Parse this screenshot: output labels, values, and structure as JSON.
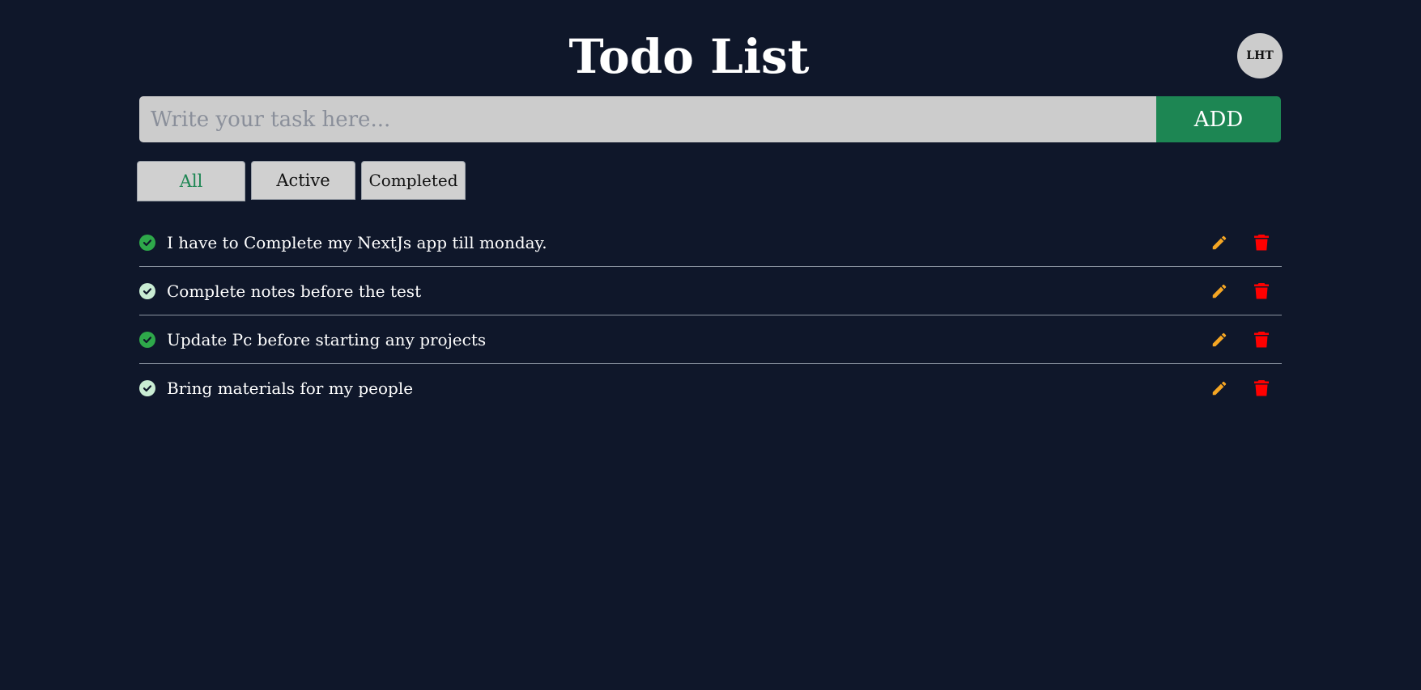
{
  "header": {
    "title": "Todo List",
    "avatar_initials": "LHT"
  },
  "add_form": {
    "placeholder": "Write your task here...",
    "value": "",
    "add_label": "ADD"
  },
  "tabs": [
    {
      "label": "All",
      "active": true
    },
    {
      "label": "Active",
      "active": false
    },
    {
      "label": "Completed",
      "active": false
    }
  ],
  "todos": [
    {
      "text": "I have to Complete my NextJs app till monday.",
      "status_icon": "check-circle-icon",
      "check_color": "#2ea84a"
    },
    {
      "text": "Complete notes before the test",
      "status_icon": "check-circle-icon",
      "check_color": "#c9ecd3"
    },
    {
      "text": "Update Pc before starting any projects",
      "status_icon": "check-circle-icon",
      "check_color": "#2ea84a"
    },
    {
      "text": "Bring materials for my people",
      "status_icon": "check-circle-icon",
      "check_color": "#c9ecd3"
    }
  ],
  "colors": {
    "background": "#0f172a",
    "accent_green": "#1d8653",
    "edit_icon": "#f5a623",
    "delete_icon": "#ff0000"
  }
}
